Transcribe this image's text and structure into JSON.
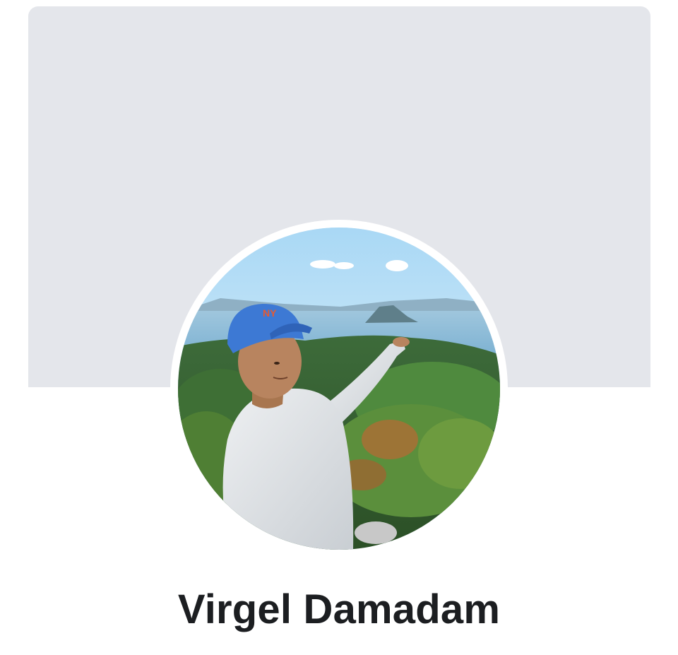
{
  "profile": {
    "name": "Virgel Damadam",
    "cover_color": "#e4e6eb",
    "avatar_icon": "profile-photo"
  }
}
